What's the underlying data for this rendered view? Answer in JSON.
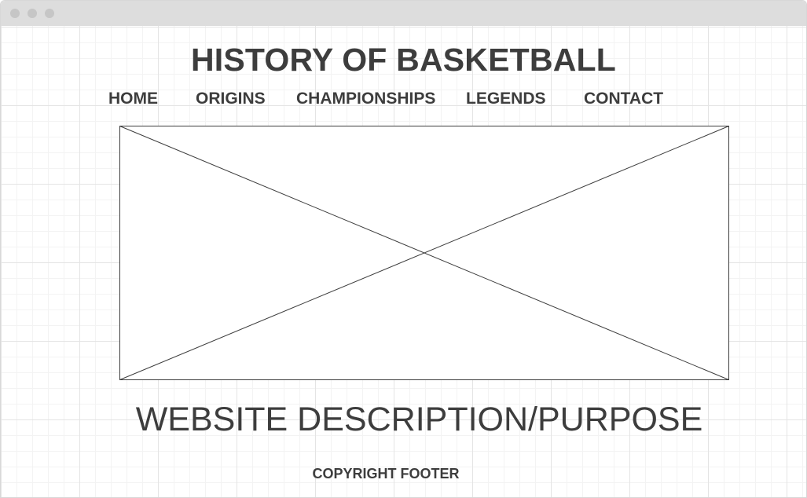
{
  "site": {
    "title": "HISTORY OF BASKETBALL"
  },
  "nav": {
    "items": [
      {
        "label": "HOME"
      },
      {
        "label": "ORIGINS"
      },
      {
        "label": "CHAMPIONSHIPS"
      },
      {
        "label": "LEGENDS"
      },
      {
        "label": "CONTACT"
      }
    ]
  },
  "hero": {
    "description": "WEBSITE DESCRIPTION/PURPOSE"
  },
  "footer": {
    "text": "COPYRIGHT FOOTER"
  },
  "colors": {
    "text": "#3d3d3d",
    "placeholder_stroke": "#3d3d3d",
    "titlebar": "#dddddd"
  },
  "icons": {
    "window_controls": [
      "window-close-dot-icon",
      "window-minimize-dot-icon",
      "window-maximize-dot-icon"
    ],
    "image_placeholder": "image-placeholder-icon"
  }
}
